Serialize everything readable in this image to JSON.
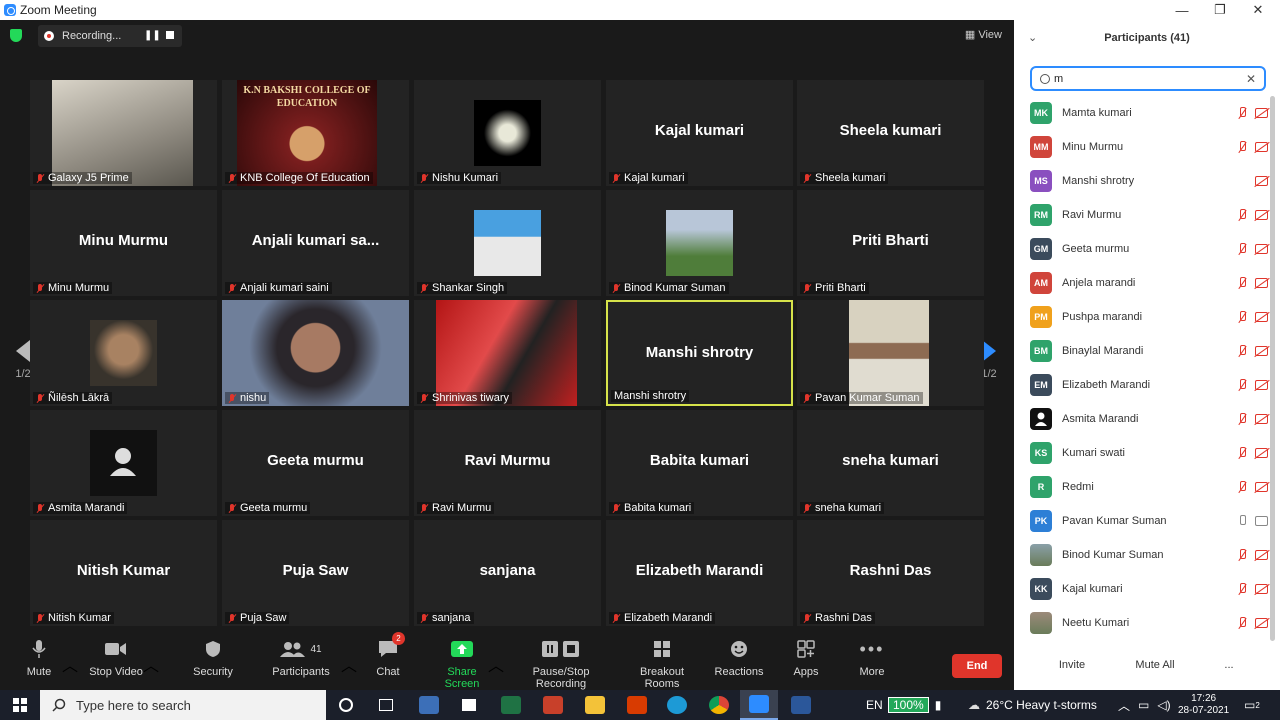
{
  "window": {
    "title": "Zoom Meeting",
    "minimize": "—",
    "maximize": "❐",
    "close": "✕"
  },
  "recording": {
    "label": "Recording..."
  },
  "view_label": "View",
  "page": {
    "left": "1/2",
    "right": "1/2"
  },
  "tiles": [
    {
      "name": "Galaxy J5 Prime",
      "big": "",
      "video": "person"
    },
    {
      "name": "KNB College Of Education",
      "big": "",
      "video": "college",
      "banner": "K.N BAKSHI COLLEGE OF EDUCATION"
    },
    {
      "name": "Nishu Kumari",
      "big": "",
      "video": "flower"
    },
    {
      "name": "Kajal kumari",
      "big": "Kajal kumari",
      "video": ""
    },
    {
      "name": "Sheela kumari",
      "big": "Sheela kumari",
      "video": ""
    },
    {
      "name": "Minu Murmu",
      "big": "Minu Murmu",
      "video": ""
    },
    {
      "name": "Anjali kumari saini",
      "big": "Anjali kumari sa...",
      "video": ""
    },
    {
      "name": "Shankar Singh",
      "big": "",
      "video": "portrait"
    },
    {
      "name": "Binod Kumar Suman",
      "big": "",
      "video": "outdoor"
    },
    {
      "name": "Priti Bharti",
      "big": "Priti Bharti",
      "video": ""
    },
    {
      "name": "Ñilēsh Lākrā",
      "big": "",
      "video": "sunglasses"
    },
    {
      "name": "nishu",
      "big": "",
      "video": "girl"
    },
    {
      "name": "Shrinivas tiwary",
      "big": "",
      "video": "red"
    },
    {
      "name": "Manshi shrotry",
      "big": "Manshi shrotry",
      "video": "",
      "active": true
    },
    {
      "name": "Pavan Kumar Suman",
      "big": "",
      "video": "man"
    },
    {
      "name": "Asmita Marandi",
      "big": "",
      "video": "silhouette"
    },
    {
      "name": "Geeta murmu",
      "big": "Geeta murmu",
      "video": ""
    },
    {
      "name": "Ravi Murmu",
      "big": "Ravi Murmu",
      "video": ""
    },
    {
      "name": "Babita kumari",
      "big": "Babita kumari",
      "video": ""
    },
    {
      "name": "sneha kumari",
      "big": "sneha kumari",
      "video": ""
    },
    {
      "name": "Nitish Kumar",
      "big": "Nitish Kumar",
      "video": ""
    },
    {
      "name": "Puja Saw",
      "big": "Puja Saw",
      "video": ""
    },
    {
      "name": "sanjana",
      "big": "sanjana",
      "video": ""
    },
    {
      "name": "Elizabeth Marandi",
      "big": "Elizabeth Marandi",
      "video": ""
    },
    {
      "name": "Rashni Das",
      "big": "Rashni Das",
      "video": ""
    }
  ],
  "toolbar": {
    "mute": "Mute",
    "stop_video": "Stop Video",
    "security": "Security",
    "participants": "Participants",
    "participants_count": "41",
    "chat": "Chat",
    "chat_badge": "2",
    "share": "Share Screen",
    "recording": "Pause/Stop Recording",
    "breakout": "Breakout Rooms",
    "reactions": "Reactions",
    "apps": "Apps",
    "more": "More",
    "end": "End"
  },
  "panel": {
    "title": "Participants (41)",
    "search_value": "m",
    "invite": "Invite",
    "mute_all": "Mute All",
    "more": "...",
    "participants": [
      {
        "initials": "MK",
        "name": "Mamta kumari",
        "color": "#2fa36b",
        "mic": "off"
      },
      {
        "initials": "MM",
        "name": "Minu Murmu",
        "color": "#d0453b",
        "mic": "off"
      },
      {
        "initials": "MS",
        "name": "Manshi shrotry",
        "color": "#8a4fbf",
        "mic": "none"
      },
      {
        "initials": "RM",
        "name": "Ravi Murmu",
        "color": "#2fa36b",
        "mic": "off"
      },
      {
        "initials": "GM",
        "name": "Geeta murmu",
        "color": "#3b4b5c",
        "mic": "off"
      },
      {
        "initials": "AM",
        "name": "Anjela marandi",
        "color": "#d0453b",
        "mic": "off"
      },
      {
        "initials": "PM",
        "name": "Pushpa marandi",
        "color": "#f0a11c",
        "mic": "off"
      },
      {
        "initials": "BM",
        "name": "Binaylal Marandi",
        "color": "#2fa36b",
        "mic": "off"
      },
      {
        "initials": "EM",
        "name": "Elizabeth Marandi",
        "color": "#3b4b5c",
        "mic": "off"
      },
      {
        "initials": "",
        "name": "Asmita Marandi",
        "color": "#111111",
        "mic": "off",
        "silhouette": true
      },
      {
        "initials": "KS",
        "name": "Kumari swati",
        "color": "#2fa36b",
        "mic": "off"
      },
      {
        "initials": "R",
        "name": "Redmi",
        "color": "#2fa36b",
        "mic": "off"
      },
      {
        "initials": "PK",
        "name": "Pavan Kumar Suman",
        "color": "#2d7fd6",
        "mic": "on"
      },
      {
        "initials": "",
        "name": "Binod Kumar Suman",
        "color": "#8aa0a8",
        "mic": "off",
        "photo": true
      },
      {
        "initials": "KK",
        "name": "Kajal kumari",
        "color": "#3b4b5c",
        "mic": "off"
      },
      {
        "initials": "",
        "name": "Neetu Kumari",
        "color": "#9c8a7a",
        "mic": "off",
        "photo": true
      }
    ]
  },
  "taskbar": {
    "search_placeholder": "Type here to search",
    "lang": "EN",
    "battery": "100%",
    "weather": "26°C  Heavy t-storms",
    "time": "17:26",
    "date": "28-07-2021",
    "notif_count": "2"
  }
}
